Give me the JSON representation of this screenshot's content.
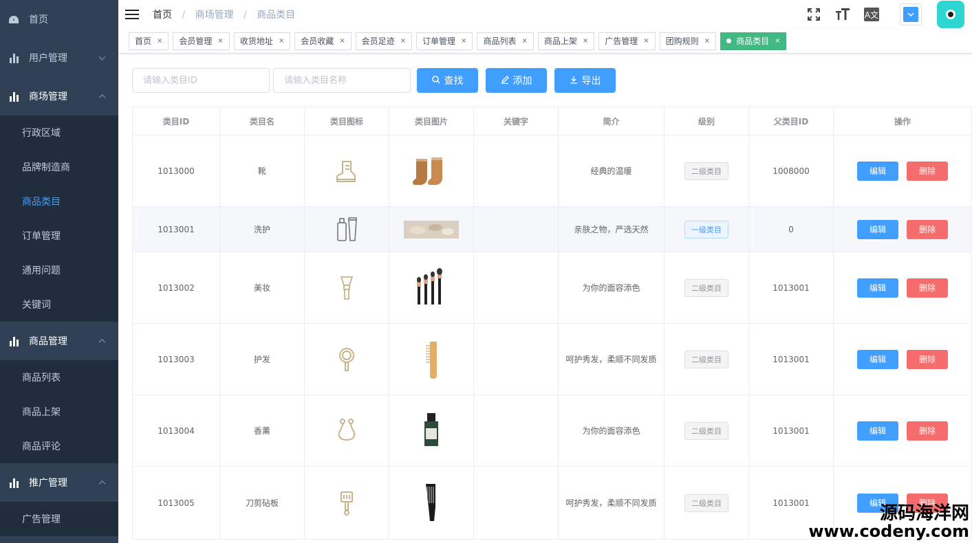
{
  "sidebar": {
    "items": [
      {
        "label": "首页",
        "icon": "dashboard-icon"
      },
      {
        "label": "用户管理",
        "icon": "chart-icon",
        "state": "collapsed"
      },
      {
        "label": "商场管理",
        "icon": "chart-icon",
        "state": "expanded",
        "children": [
          {
            "label": "行政区域"
          },
          {
            "label": "品牌制造商"
          },
          {
            "label": "商品类目",
            "active": true
          },
          {
            "label": "订单管理"
          },
          {
            "label": "通用问题"
          },
          {
            "label": "关键词"
          }
        ]
      },
      {
        "label": "商品管理",
        "icon": "chart-icon",
        "state": "expanded",
        "children": [
          {
            "label": "商品列表"
          },
          {
            "label": "商品上架"
          },
          {
            "label": "商品评论"
          }
        ]
      },
      {
        "label": "推广管理",
        "icon": "chart-icon",
        "state": "expanded",
        "children": [
          {
            "label": "广告管理"
          }
        ]
      }
    ]
  },
  "breadcrumb": [
    "首页",
    "商场管理",
    "商品类目"
  ],
  "header": {
    "lang_label": "A文"
  },
  "tags": [
    {
      "label": "首页"
    },
    {
      "label": "会员管理"
    },
    {
      "label": "收货地址"
    },
    {
      "label": "会员收藏"
    },
    {
      "label": "会员足迹"
    },
    {
      "label": "订单管理"
    },
    {
      "label": "商品列表"
    },
    {
      "label": "商品上架"
    },
    {
      "label": "广告管理"
    },
    {
      "label": "团购规则"
    },
    {
      "label": "商品类目",
      "active": true
    }
  ],
  "filter": {
    "id_placeholder": "请输入类目ID",
    "name_placeholder": "请输入类目名称",
    "search_label": "查找",
    "add_label": "添加",
    "export_label": "导出"
  },
  "table": {
    "columns": [
      "类目ID",
      "类目名",
      "类目图标",
      "类目图片",
      "关键字",
      "简介",
      "级别",
      "父类目ID",
      "操作"
    ],
    "rows": [
      {
        "id": "1013000",
        "name": "靴",
        "icon": "boot-icon",
        "image": "boots",
        "keyword": "",
        "desc": "经典的温暖",
        "level": "二级类目",
        "parent": "1008000"
      },
      {
        "id": "1013001",
        "name": "洗护",
        "icon": "bottles-icon",
        "image": "care",
        "keyword": "",
        "desc": "亲肤之物，严选天然",
        "level": "一级类目",
        "parent": "0"
      },
      {
        "id": "1013002",
        "name": "美妆",
        "icon": "brush-icon",
        "image": "brushes",
        "keyword": "",
        "desc": "为你的面容添色",
        "level": "二级类目",
        "parent": "1013001"
      },
      {
        "id": "1013003",
        "name": "护发",
        "icon": "mirror-icon",
        "image": "comb",
        "keyword": "",
        "desc": "呵护秀发，柔顺不同发质",
        "level": "二级类目",
        "parent": "1013001"
      },
      {
        "id": "1013004",
        "name": "香薰",
        "icon": "pouch-icon",
        "image": "oil-bottle",
        "keyword": "",
        "desc": "为你的面容添色",
        "level": "二级类目",
        "parent": "1013001"
      },
      {
        "id": "1013005",
        "name": "刀剪砧板",
        "icon": "spatula-icon",
        "image": "black-comb",
        "keyword": "",
        "desc": "呵护秀发，柔顺不同发质",
        "level": "二级类目",
        "parent": "1013001"
      }
    ],
    "edit_label": "编辑",
    "delete_label": "删除"
  },
  "watermark": {
    "line1": "源码海洋网",
    "line2": "www.codeny.com"
  },
  "colors": {
    "sidebar_bg": "#304156",
    "sidebar_sub_bg": "#1f2d3d",
    "accent": "#409eff",
    "danger": "#f56c6c",
    "tag_active": "#42b983"
  }
}
